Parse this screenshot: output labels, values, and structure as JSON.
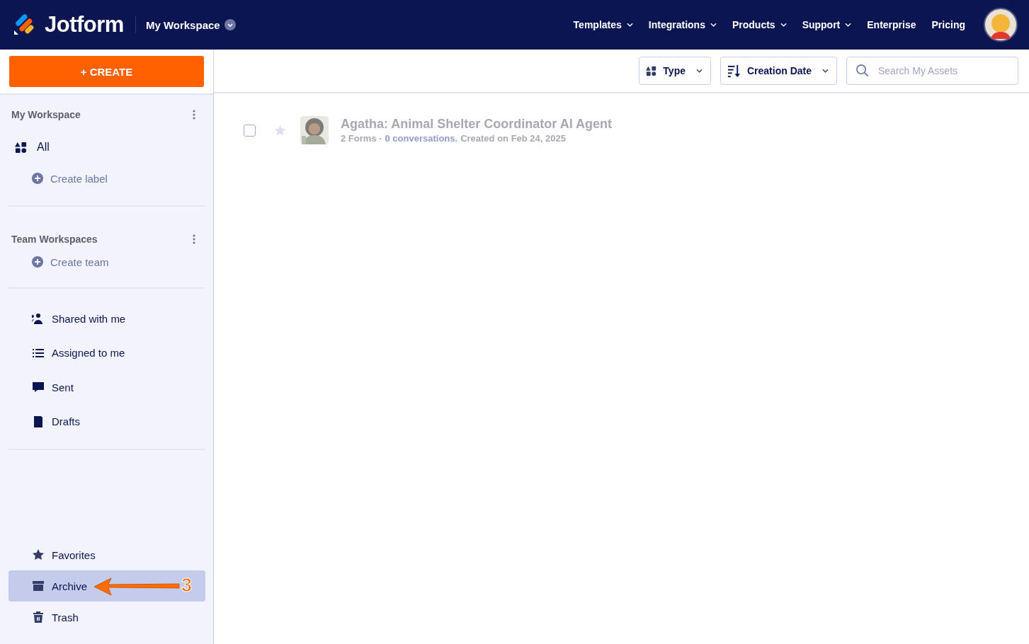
{
  "header": {
    "logo": "Jotform",
    "workspace": "My Workspace",
    "nav": [
      {
        "label": "Templates",
        "dropdown": true
      },
      {
        "label": "Integrations",
        "dropdown": true
      },
      {
        "label": "Products",
        "dropdown": true
      },
      {
        "label": "Support",
        "dropdown": true
      },
      {
        "label": "Enterprise",
        "dropdown": false
      },
      {
        "label": "Pricing",
        "dropdown": false
      }
    ]
  },
  "create_button": "+ CREATE",
  "toolbar": {
    "type_filter": "Type",
    "sort": "Creation Date",
    "search": {
      "placeholder": "Search My Assets"
    }
  },
  "sidebar": {
    "my_workspace": {
      "title": "My Workspace",
      "all": {
        "label": "All",
        "selected": false
      },
      "create": "Create label"
    },
    "team_workspaces": {
      "title": "Team Workspaces",
      "create": "Create team"
    },
    "links": [
      {
        "label": "Shared with me",
        "selected": false
      },
      {
        "label": "Assigned to me",
        "selected": false
      },
      {
        "label": "Sent",
        "selected": false
      },
      {
        "label": "Drafts",
        "selected": false
      }
    ],
    "bottom": [
      {
        "label": "Favorites",
        "selected": false
      },
      {
        "label": "Archive",
        "selected": true
      },
      {
        "label": "Trash",
        "selected": false
      }
    ]
  },
  "assets": [
    {
      "title": "Agatha: Animal Shelter Coordinator AI Agent",
      "forms": "2 Forms ·",
      "conversations": "0 conversations.",
      "created": "Created on Feb 24, 2025",
      "checked": false,
      "starred": false,
      "dimmed": true
    }
  ],
  "annotation": {
    "label": "3"
  }
}
